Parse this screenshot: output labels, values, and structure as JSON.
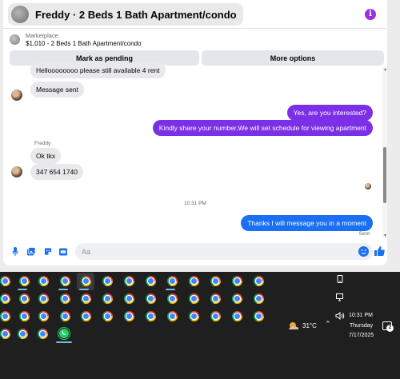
{
  "header": {
    "title": "Freddy · 2 Beds 1 Bath Apartment/condo",
    "info_icon": "info-icon",
    "info_glyph": "i",
    "accent": "#9b30e0"
  },
  "listing": {
    "source": "Marketplace",
    "title": "$1,010 - 2 Beds 1 Bath Apartment/condo"
  },
  "actions": {
    "mark_pending": "Mark as pending",
    "more_options": "More options"
  },
  "messages": {
    "partial_incoming": "Helloooooooo please still available 4 rent",
    "incoming_1": "Message sent",
    "outgoing_1": "Yes, are you interested?",
    "outgoing_2": "Kindly share your number,We will set schedule for viewing apartment",
    "sender_name": "Freddy",
    "incoming_2": "Ok tkx",
    "incoming_3": "347 654 1740",
    "timestamp": "10:31 PM",
    "outgoing_3": "Thanks I will message you in a moment",
    "status": "Sent",
    "outgoing_color": "#7b2fe6",
    "outgoing_blue": "#1a6ff3"
  },
  "composer": {
    "placeholder": "Aa",
    "value": "",
    "icons": [
      "microphone-icon",
      "photo-icon",
      "sticker-icon",
      "gif-icon",
      "emoji-icon",
      "like-icon"
    ]
  },
  "taskbar": {
    "weather_temp": "31°C",
    "time": "10:31 PM",
    "day": "Thursday",
    "date": "7/17/2025",
    "notification_count": "2",
    "apps": [
      "chrome-icon",
      "whatsapp-icon"
    ]
  }
}
